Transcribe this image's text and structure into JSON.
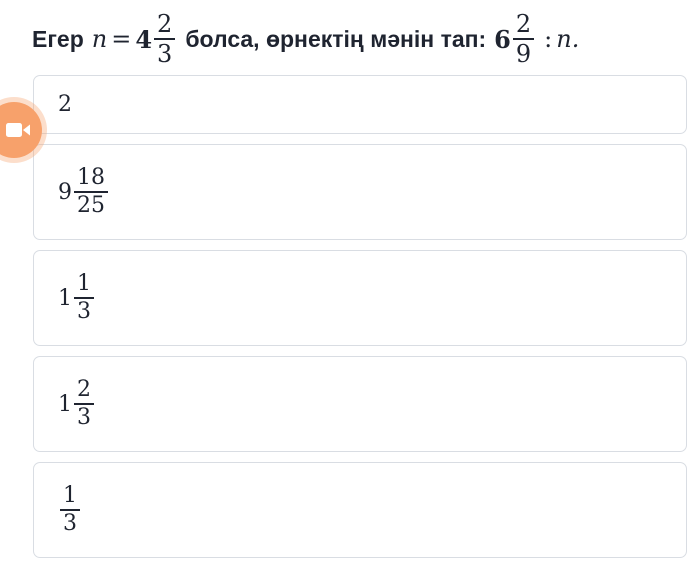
{
  "question": {
    "prefix": "Егер",
    "var_n": "n",
    "equals": "=",
    "n_whole": "4",
    "n_num": "2",
    "n_den": "3",
    "middle": "болса, өрнектің мәнін тап:",
    "expr_whole": "6",
    "expr_num": "2",
    "expr_den": "9",
    "divide": ":",
    "expr_var": "n."
  },
  "options": [
    {
      "text": "2"
    },
    {
      "whole": "9",
      "num": "18",
      "den": "25"
    },
    {
      "whole": "1",
      "num": "1",
      "den": "3"
    },
    {
      "whole": "1",
      "num": "2",
      "den": "3"
    },
    {
      "num": "1",
      "den": "3"
    }
  ],
  "overlay": {
    "icon": "video-camera-icon",
    "color": "#f7a16b"
  }
}
